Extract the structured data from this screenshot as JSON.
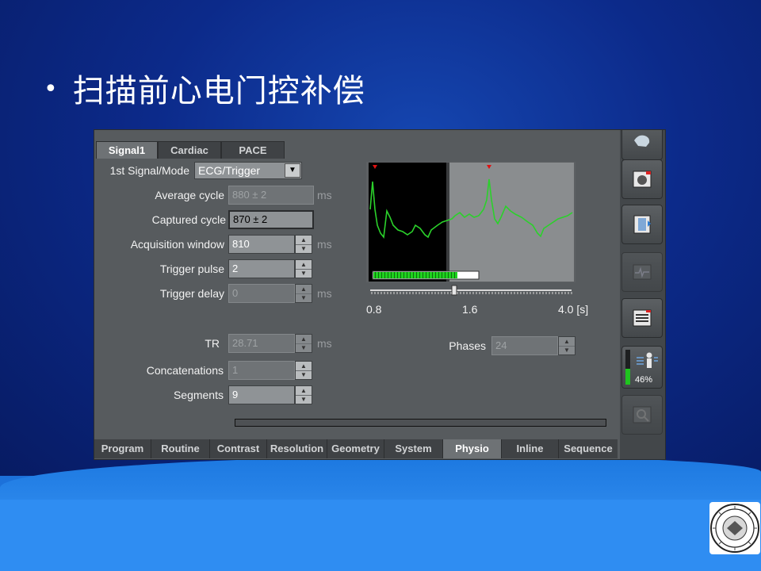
{
  "slide": {
    "bullet": "•",
    "title": "扫描前心电门控补偿"
  },
  "panel": {
    "top_tabs": [
      {
        "label": "Signal1",
        "active": true
      },
      {
        "label": "Cardiac",
        "active": false
      },
      {
        "label": "PACE",
        "active": false
      }
    ],
    "signal_mode": {
      "label": "1st Signal/Mode",
      "value": "ECG/Trigger"
    },
    "average_cycle": {
      "label": "Average cycle",
      "value": "880 ± 2",
      "unit": "ms"
    },
    "captured_cycle": {
      "label": "Captured cycle",
      "value": "870 ± 2"
    },
    "acquisition_window": {
      "label": "Acquisition window",
      "value": "810",
      "unit": "ms"
    },
    "trigger_pulse": {
      "label": "Trigger pulse",
      "value": "2"
    },
    "trigger_delay": {
      "label": "Trigger delay",
      "value": "0",
      "unit": "ms"
    },
    "tr": {
      "label": "TR",
      "value": "28.71",
      "unit": "ms"
    },
    "concatenations": {
      "label": "Concatenations",
      "value": "1"
    },
    "segments": {
      "label": "Segments",
      "value": "9"
    },
    "phases": {
      "label": "Phases",
      "value": "24"
    },
    "ecg": {
      "axis_labels": [
        "0.8",
        "1.6",
        "4.0 [s]"
      ],
      "progress": 0.8,
      "slider_value": 0.42,
      "trace_color": "#2bd12b",
      "marker_color": "#e01010"
    },
    "bottom_tabs": [
      {
        "label": "Program",
        "active": false
      },
      {
        "label": "Routine",
        "active": false
      },
      {
        "label": "Contrast",
        "active": false
      },
      {
        "label": "Resolution",
        "active": false
      },
      {
        "label": "Geometry",
        "active": false
      },
      {
        "label": "System",
        "active": false
      },
      {
        "label": "Physio",
        "active": true
      },
      {
        "label": "Inline",
        "active": false
      },
      {
        "label": "Sequence",
        "active": false
      }
    ],
    "sidebar": {
      "buttons": [
        {
          "icon": "patient-head-icon"
        },
        {
          "icon": "image-window-icon"
        },
        {
          "icon": "patient-table-icon"
        },
        {
          "icon": "ecg-monitor-icon"
        },
        {
          "icon": "protocol-list-icon"
        },
        {
          "icon": "sar-patient-icon",
          "label": "46%"
        },
        {
          "icon": "zoom-view-icon"
        }
      ]
    }
  },
  "colors": {
    "panel_bg": "#575b5e",
    "active_tab": "#6e7275",
    "slide_title": "#ffffff"
  }
}
